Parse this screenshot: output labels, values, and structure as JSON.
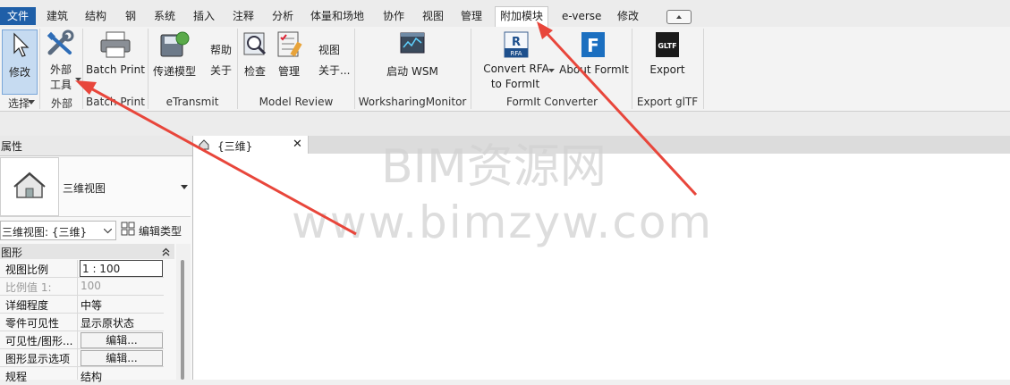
{
  "menu": {
    "file": "文件",
    "tabs": [
      "建筑",
      "结构",
      "钢",
      "系统",
      "插入",
      "注释",
      "分析",
      "体量和场地",
      "协作",
      "视图",
      "管理",
      "附加模块",
      "e-verse",
      "修改"
    ]
  },
  "ribbon": {
    "select": {
      "modify": "修改",
      "panel": "选择"
    },
    "external": {
      "line1": "外部",
      "line2": "工具",
      "panel": "外部"
    },
    "batch_print": {
      "label": "Batch Print",
      "panel": "Batch Print"
    },
    "etransmit": {
      "label": "传递模型",
      "help": "帮助",
      "about": "关于",
      "panel": "eTransmit"
    },
    "model_review": {
      "check": "检查",
      "manage": "管理",
      "view": "视图",
      "about": "关于...",
      "panel": "Model Review"
    },
    "worksharing": {
      "label": "启动 WSM",
      "panel": "WorksharingMonitor"
    },
    "formit": {
      "convert_line1": "Convert RFA",
      "convert_line2": "to FormIt",
      "about": "About FormIt",
      "panel": "FormIt Converter",
      "rfa_badge": "RFA"
    },
    "gltf": {
      "label": "Export",
      "panel": "Export glTF",
      "badge": "GLTF"
    }
  },
  "properties": {
    "title": "属性",
    "type_name": "三维视图",
    "instance_selector": "三维视图: {三维}",
    "edit_type": "编辑类型",
    "group": "图形",
    "rows": [
      {
        "key": "视图比例",
        "value": "1 : 100"
      },
      {
        "key": "比例值 1:",
        "value": "100"
      },
      {
        "key": "详细程度",
        "value": "中等"
      },
      {
        "key": "零件可见性",
        "value": "显示原状态"
      },
      {
        "key": "可见性/图形...",
        "value": "编辑..."
      },
      {
        "key": "图形显示选项",
        "value": "编辑..."
      },
      {
        "key": "规程",
        "value": "结构"
      }
    ]
  },
  "view_tab": {
    "label": "{三维}",
    "close": "✕"
  },
  "watermark": {
    "line1": "BIM资源网",
    "line2": "www.bimzyw.com"
  },
  "colors": {
    "accent": "#1f5fa8",
    "arrow": "#e8463b"
  }
}
